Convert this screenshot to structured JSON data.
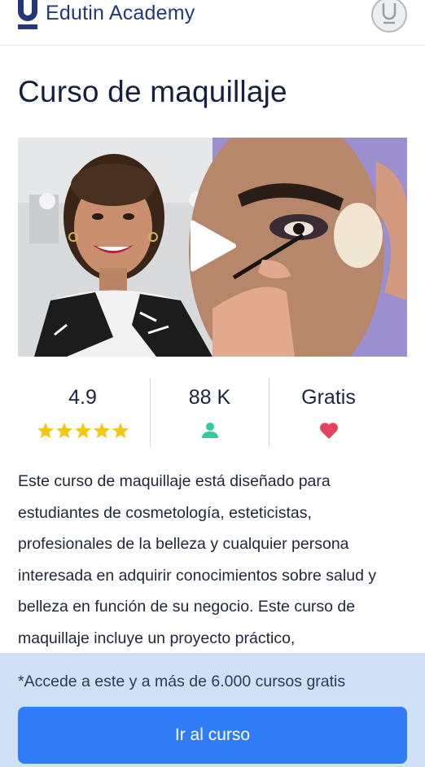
{
  "header": {
    "brand": "Edutin Academy",
    "logo_icon": "edutin-logo-icon",
    "avatar_icon": "user-avatar-icon"
  },
  "course": {
    "title": "Curso de maquillaje"
  },
  "video": {
    "play_icon": "play-icon"
  },
  "stats": {
    "rating": "4.9",
    "rating_stars": 5,
    "students": "88 K",
    "price": "Gratis",
    "icons": [
      "star-icon",
      "user-icon",
      "heart-icon"
    ]
  },
  "description": "Este curso de maquillaje está diseñado para estudiantes de cosmetología, esteticistas, profesionales de la belleza y cualquier persona interesada en adquirir conocimientos sobre salud y belleza en función de su negocio. Este curso de maquillaje incluye un proyecto práctico,",
  "cta": {
    "note": "*Accede a este y a más de 6.000 cursos gratis",
    "button_label": "Ir al curso"
  },
  "colors": {
    "brand": "#22387a",
    "primary_button": "#2f7cf6",
    "cta_panel": "#cfe0f7",
    "star": "#f5c518",
    "user": "#35c8a0",
    "heart": "#e2445c"
  }
}
